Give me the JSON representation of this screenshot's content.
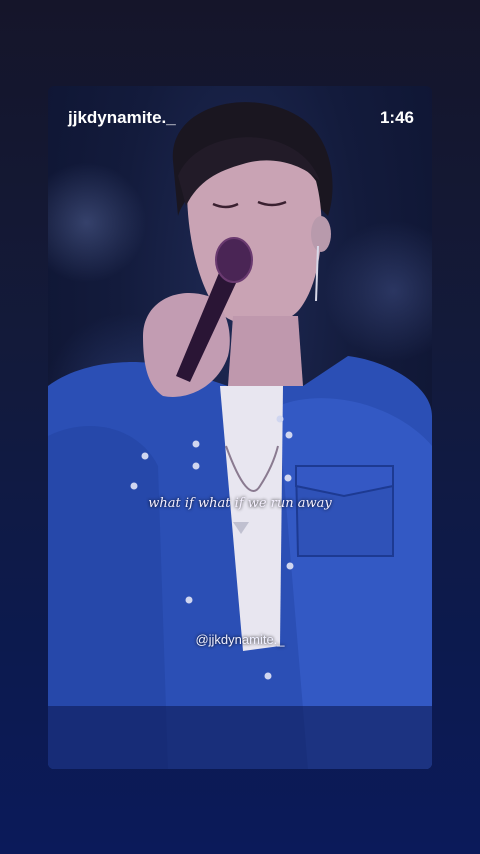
{
  "header": {
    "username": "jjkdynamite._",
    "time": "1:46"
  },
  "video": {
    "lyric": "what if what if we run away",
    "watermark": "@jjkdynamite._"
  },
  "colors": {
    "background_top": "#15152a",
    "background_bottom": "#0b1a5a",
    "jacket": "#2b4fb5",
    "text": "#ffffff"
  }
}
